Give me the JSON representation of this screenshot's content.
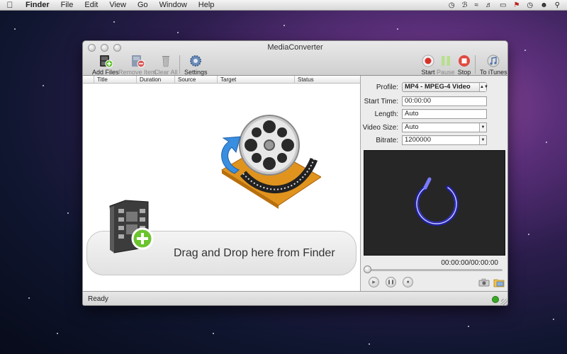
{
  "menubar": {
    "app_name": "Finder",
    "items": [
      "File",
      "Edit",
      "View",
      "Go",
      "Window",
      "Help"
    ],
    "status_icons": [
      "time-machine-icon",
      "bluetooth-icon",
      "wifi-icon",
      "volume-icon",
      "battery-icon",
      "flag-icon",
      "clock-icon",
      "user-icon",
      "spotlight-icon"
    ]
  },
  "window": {
    "title": "MediaConverter",
    "toolbar": {
      "add_files": "Add Files",
      "remove_item": "Remove Item",
      "clear_all": "Clear All",
      "settings": "Settings",
      "start": "Start",
      "pause": "Pause",
      "stop": "Stop",
      "to_itunes": "To iTunes"
    },
    "table": {
      "columns": [
        "Title",
        "Duration",
        "Source",
        "Target",
        "Status"
      ]
    },
    "dropzone": {
      "text": "Drag and Drop here from Finder"
    },
    "settings": {
      "profile_label": "Profile:",
      "profile_value": "MP4 - MPEG-4 Video",
      "start_time_label": "Start Time:",
      "start_time_value": "00:00:00",
      "length_label": "Length:",
      "length_value": "Auto",
      "video_size_label": "Video Size:",
      "video_size_value": "Auto",
      "bitrate_label": "Bitrate:",
      "bitrate_value": "1200000"
    },
    "player": {
      "timecode": "00:00:00/00:00:00",
      "position": 0
    },
    "status": {
      "text": "Ready",
      "color": "#3aa826"
    }
  },
  "colors": {
    "record": "#d9302a",
    "pause": "#b8e08c",
    "stop": "#e04a40",
    "spinner": "#4a4ad8"
  }
}
